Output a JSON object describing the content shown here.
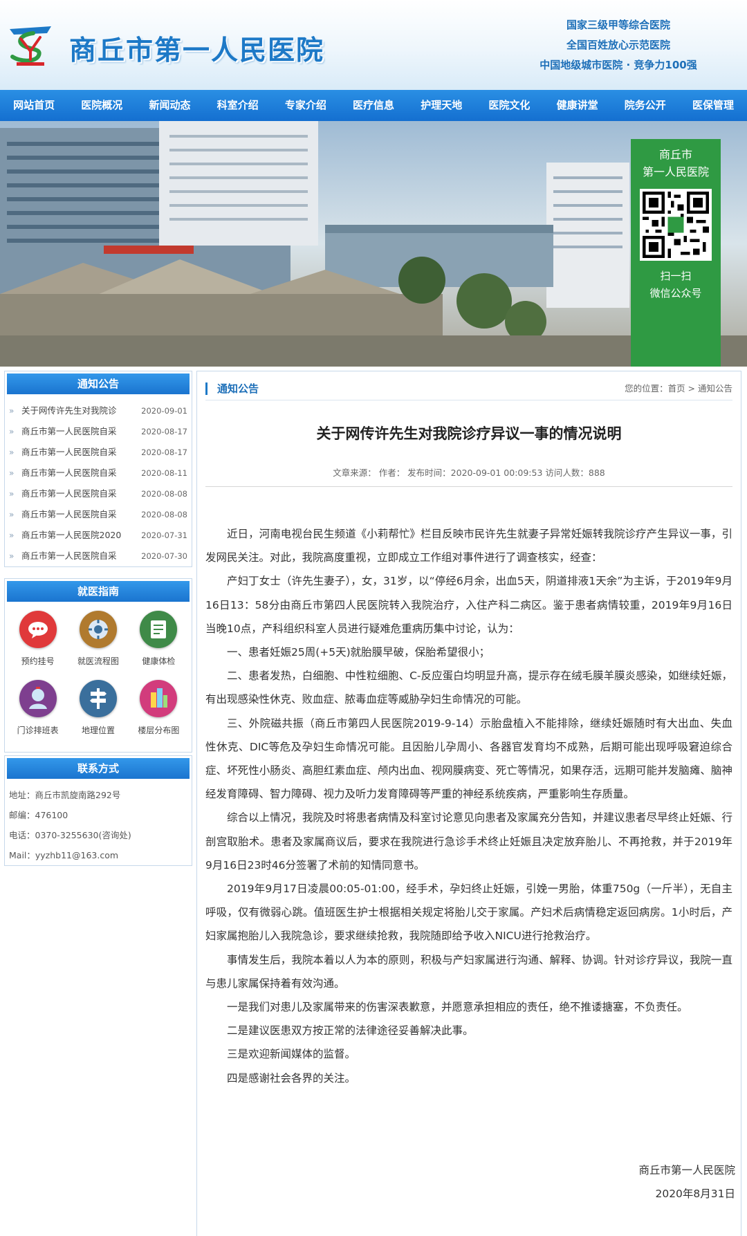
{
  "header": {
    "site_name": "商丘市第一人民医院",
    "logo_text": "SY",
    "honors": [
      "国家三级甲等综合医院",
      "全国百姓放心示范医院",
      "中国地级城市医院 · 竞争力100强"
    ]
  },
  "nav": [
    "网站首页",
    "医院概况",
    "新闻动态",
    "科室介绍",
    "专家介绍",
    "医疗信息",
    "护理天地",
    "医院文化",
    "健康讲堂",
    "院务公开",
    "医保管理"
  ],
  "banner": {
    "qr_title_line1": "商丘市",
    "qr_title_line2": "第一人民医院",
    "qr_foot_line1": "扫一扫",
    "qr_foot_line2": "微信公众号"
  },
  "sidebar": {
    "notice": {
      "title": "通知公告",
      "items": [
        {
          "title": "关于网传许先生对我院诊",
          "date": "2020-09-01"
        },
        {
          "title": "商丘市第一人民医院自采",
          "date": "2020-08-17"
        },
        {
          "title": "商丘市第一人民医院自采",
          "date": "2020-08-17"
        },
        {
          "title": "商丘市第一人民医院自采",
          "date": "2020-08-11"
        },
        {
          "title": "商丘市第一人民医院自采",
          "date": "2020-08-08"
        },
        {
          "title": "商丘市第一人民医院自采",
          "date": "2020-08-08"
        },
        {
          "title": "商丘市第一人民医院2020",
          "date": "2020-07-31"
        },
        {
          "title": "商丘市第一人民医院自采",
          "date": "2020-07-30"
        }
      ]
    },
    "guide": {
      "title": "就医指南",
      "items": [
        {
          "label": "预约挂号",
          "icon": "appointment-icon",
          "color": "#e0393a"
        },
        {
          "label": "就医流程图",
          "icon": "process-icon",
          "color": "#b07a2e"
        },
        {
          "label": "健康体检",
          "icon": "checkup-icon",
          "color": "#3f8a48"
        },
        {
          "label": "门诊排班表",
          "icon": "schedule-icon",
          "color": "#7e3f8f"
        },
        {
          "label": "地理位置",
          "icon": "signpost-icon",
          "color": "#3a6f9c"
        },
        {
          "label": "楼层分布图",
          "icon": "floor-map-icon",
          "color": "#d23c7c"
        }
      ]
    },
    "contact": {
      "title": "联系方式",
      "address": "地址：商丘市凯旋南路292号",
      "postcode": "邮编：476100",
      "phone": "电话：0370-3255630(咨询处)",
      "mail": "Mail：yyzhb11@163.com"
    }
  },
  "main": {
    "section_title": "通知公告",
    "breadcrumb": "您的位置：首页 > 通知公告",
    "title": "关于网传许先生对我院诊疗异议一事的情况说明",
    "meta": "文章来源：  作者：  发布时间：2020-09-01 00:09:53 访问人数：888",
    "paragraphs": [
      "近日，河南电视台民生频道《小莉帮忙》栏目反映市民许先生就妻子异常妊娠转我院诊疗产生异议一事，引发网民关注。对此，我院高度重视，立即成立工作组对事件进行了调查核实，经查：",
      "产妇丁女士（许先生妻子），女，31岁，以“停经6月余，出血5天，阴道排液1天余”为主诉，于2019年9月16日13：58分由商丘市第四人民医院转入我院治疗，入住产科二病区。鉴于患者病情较重，2019年9月16日当晚10点，产科组织科室人员进行疑难危重病历集中讨论，认为：",
      "一、患者妊娠25周(+5天)就胎膜早破，保胎希望很小；",
      "二、患者发热，白细胞、中性粒细胞、C-反应蛋白均明显升高，提示存在绒毛膜羊膜炎感染，如继续妊娠，有出现感染性休克、败血症、脓毒血症等威胁孕妇生命情况的可能。",
      "三、外院磁共振（商丘市第四人民医院2019-9-14）示胎盘植入不能排除，继续妊娠随时有大出血、失血性休克、DIC等危及孕妇生命情况可能。且因胎儿孕周小、各器官发育均不成熟，后期可能出现呼吸窘迫综合症、坏死性小肠炎、高胆红素血症、颅内出血、视网膜病变、死亡等情况，如果存活，远期可能并发脑瘫、脑神经发育障碍、智力障碍、视力及听力发育障碍等严重的神经系统疾病，严重影响生存质量。",
      "综合以上情况，我院及时将患者病情及科室讨论意见向患者及家属充分告知，并建议患者尽早终止妊娠、行剖宫取胎术。患者及家属商议后，要求在我院进行急诊手术终止妊娠且决定放弃胎儿、不再抢救，并于2019年9月16日23时46分签署了术前的知情同意书。",
      "2019年9月17日凌晨00:05-01:00，经手术，孕妇终止妊娠，引娩一男胎，体重750g（一斤半），无自主呼吸，仅有微弱心跳。值班医生护士根据相关规定将胎儿交于家属。产妇术后病情稳定返回病房。1小时后，产妇家属抱胎儿入我院急诊，要求继续抢救，我院随即给予收入NICU进行抢救治疗。",
      "事情发生后，我院本着以人为本的原则，积极与产妇家属进行沟通、解释、协调。针对诊疗异议，我院一直与患儿家属保持着有效沟通。",
      "一是我们对患儿及家属带来的伤害深表歉意，并愿意承担相应的责任，绝不推诿搪塞，不负责任。",
      "二是建议医患双方按正常的法律途径妥善解决此事。",
      "三是欢迎新闻媒体的监督。",
      "四是感谢社会各界的关注。"
    ],
    "signature": "商丘市第一人民医院",
    "sign_date": "2020年8月31日"
  },
  "colors": {
    "brand_blue": "#1d79c7",
    "nav_blue": "#146fd0",
    "qr_green": "#2f9a43"
  }
}
